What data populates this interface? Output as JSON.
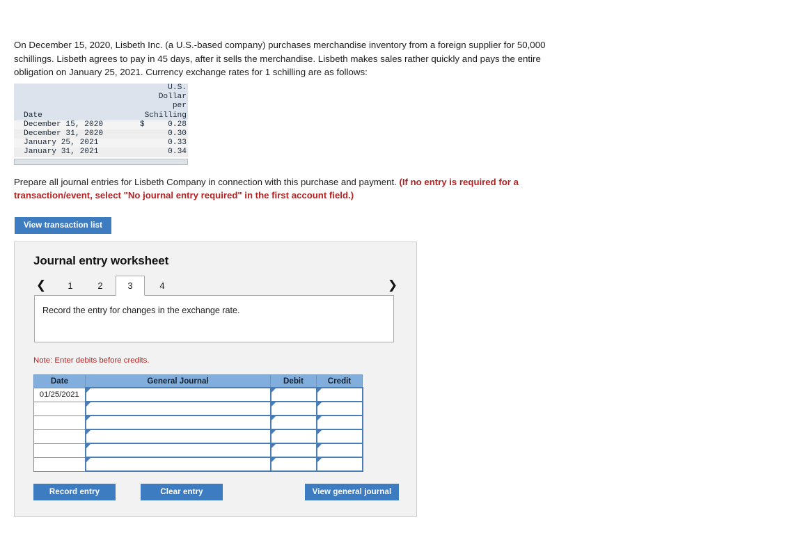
{
  "problem": {
    "statement": "On December 15, 2020, Lisbeth Inc. (a U.S.-based company) purchases merchandise inventory from a foreign supplier for 50,000 schillings. Lisbeth agrees to pay in 45 days, after it sells the merchandise. Lisbeth makes sales rather quickly and pays the entire obligation on January 25, 2021. Currency exchange rates for 1 schilling are as follows:",
    "prepare_main": "Prepare all journal entries for Lisbeth Company in connection with this purchase and payment.",
    "prepare_required": "(If no entry is required for a transaction/event, select \"No journal entry required\" in the first account field.)"
  },
  "rate_table": {
    "header_lines": [
      "U.S.",
      "Dollar",
      "per",
      "Schilling"
    ],
    "date_header": "Date",
    "rows": [
      {
        "date": "December 15, 2020",
        "currency": "$",
        "rate": "0.28"
      },
      {
        "date": "December 31, 2020",
        "currency": "",
        "rate": "0.30"
      },
      {
        "date": "January 25, 2021",
        "currency": "",
        "rate": "0.33"
      },
      {
        "date": "January 31, 2021",
        "currency": "",
        "rate": "0.34"
      }
    ]
  },
  "buttons": {
    "view_transaction_list": "View transaction list",
    "record_entry": "Record entry",
    "clear_entry": "Clear entry",
    "view_general_journal": "View general journal"
  },
  "worksheet": {
    "title": "Journal entry worksheet",
    "prev_arrow": "❮",
    "next_arrow": "❯",
    "tabs": [
      {
        "label": "1",
        "active": false
      },
      {
        "label": "2",
        "active": false
      },
      {
        "label": "3",
        "active": true
      },
      {
        "label": "4",
        "active": false
      }
    ],
    "instruction": "Record the entry for changes in the exchange rate.",
    "note": "Note: Enter debits before credits."
  },
  "journal": {
    "columns": [
      "Date",
      "General Journal",
      "Debit",
      "Credit"
    ],
    "rows": [
      {
        "date": "01/25/2021",
        "account": "",
        "debit": "",
        "credit": ""
      },
      {
        "date": "",
        "account": "",
        "debit": "",
        "credit": ""
      },
      {
        "date": "",
        "account": "",
        "debit": "",
        "credit": ""
      },
      {
        "date": "",
        "account": "",
        "debit": "",
        "credit": ""
      },
      {
        "date": "",
        "account": "",
        "debit": "",
        "credit": ""
      },
      {
        "date": "",
        "account": "",
        "debit": "",
        "credit": ""
      }
    ]
  },
  "colors": {
    "button_blue": "#3d7cc0",
    "table_header_blue": "#81aedd",
    "input_border_blue": "#4a7db5",
    "required_red": "#b22222",
    "panel_gray": "#f2f2f2",
    "rate_header_gray": "#dce3ec"
  }
}
